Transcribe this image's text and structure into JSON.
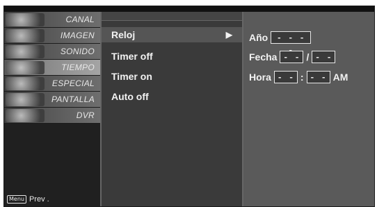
{
  "left_menu": {
    "items": [
      {
        "label": "CANAL",
        "icon": "antenna-icon"
      },
      {
        "label": "IMAGEN",
        "icon": "film-icon"
      },
      {
        "label": "SONIDO",
        "icon": "speaker-icon"
      },
      {
        "label": "TIEMPO",
        "icon": "clock-icon"
      },
      {
        "label": "ESPECIAL",
        "icon": "special-icon"
      },
      {
        "label": "PANTALLA",
        "icon": "screen-icon"
      },
      {
        "label": "DVR",
        "icon": "disc-icon"
      }
    ],
    "active_index": 3,
    "hint_key": "Menu",
    "hint_text": "Prev ."
  },
  "submenu": {
    "items": [
      {
        "label": "Reloj"
      },
      {
        "label": "Timer off"
      },
      {
        "label": "Timer on"
      },
      {
        "label": "Auto off"
      }
    ],
    "selected_index": 0,
    "arrow": "▶"
  },
  "clock_panel": {
    "year_label": "Año",
    "year_value": "- - - -",
    "date_label": "Fecha",
    "date_month": "- -",
    "date_separator": "/",
    "date_day": "- -",
    "time_label": "Hora",
    "time_hour": "- -",
    "time_separator": ":",
    "time_minute": "- -",
    "ampm": "AM"
  }
}
